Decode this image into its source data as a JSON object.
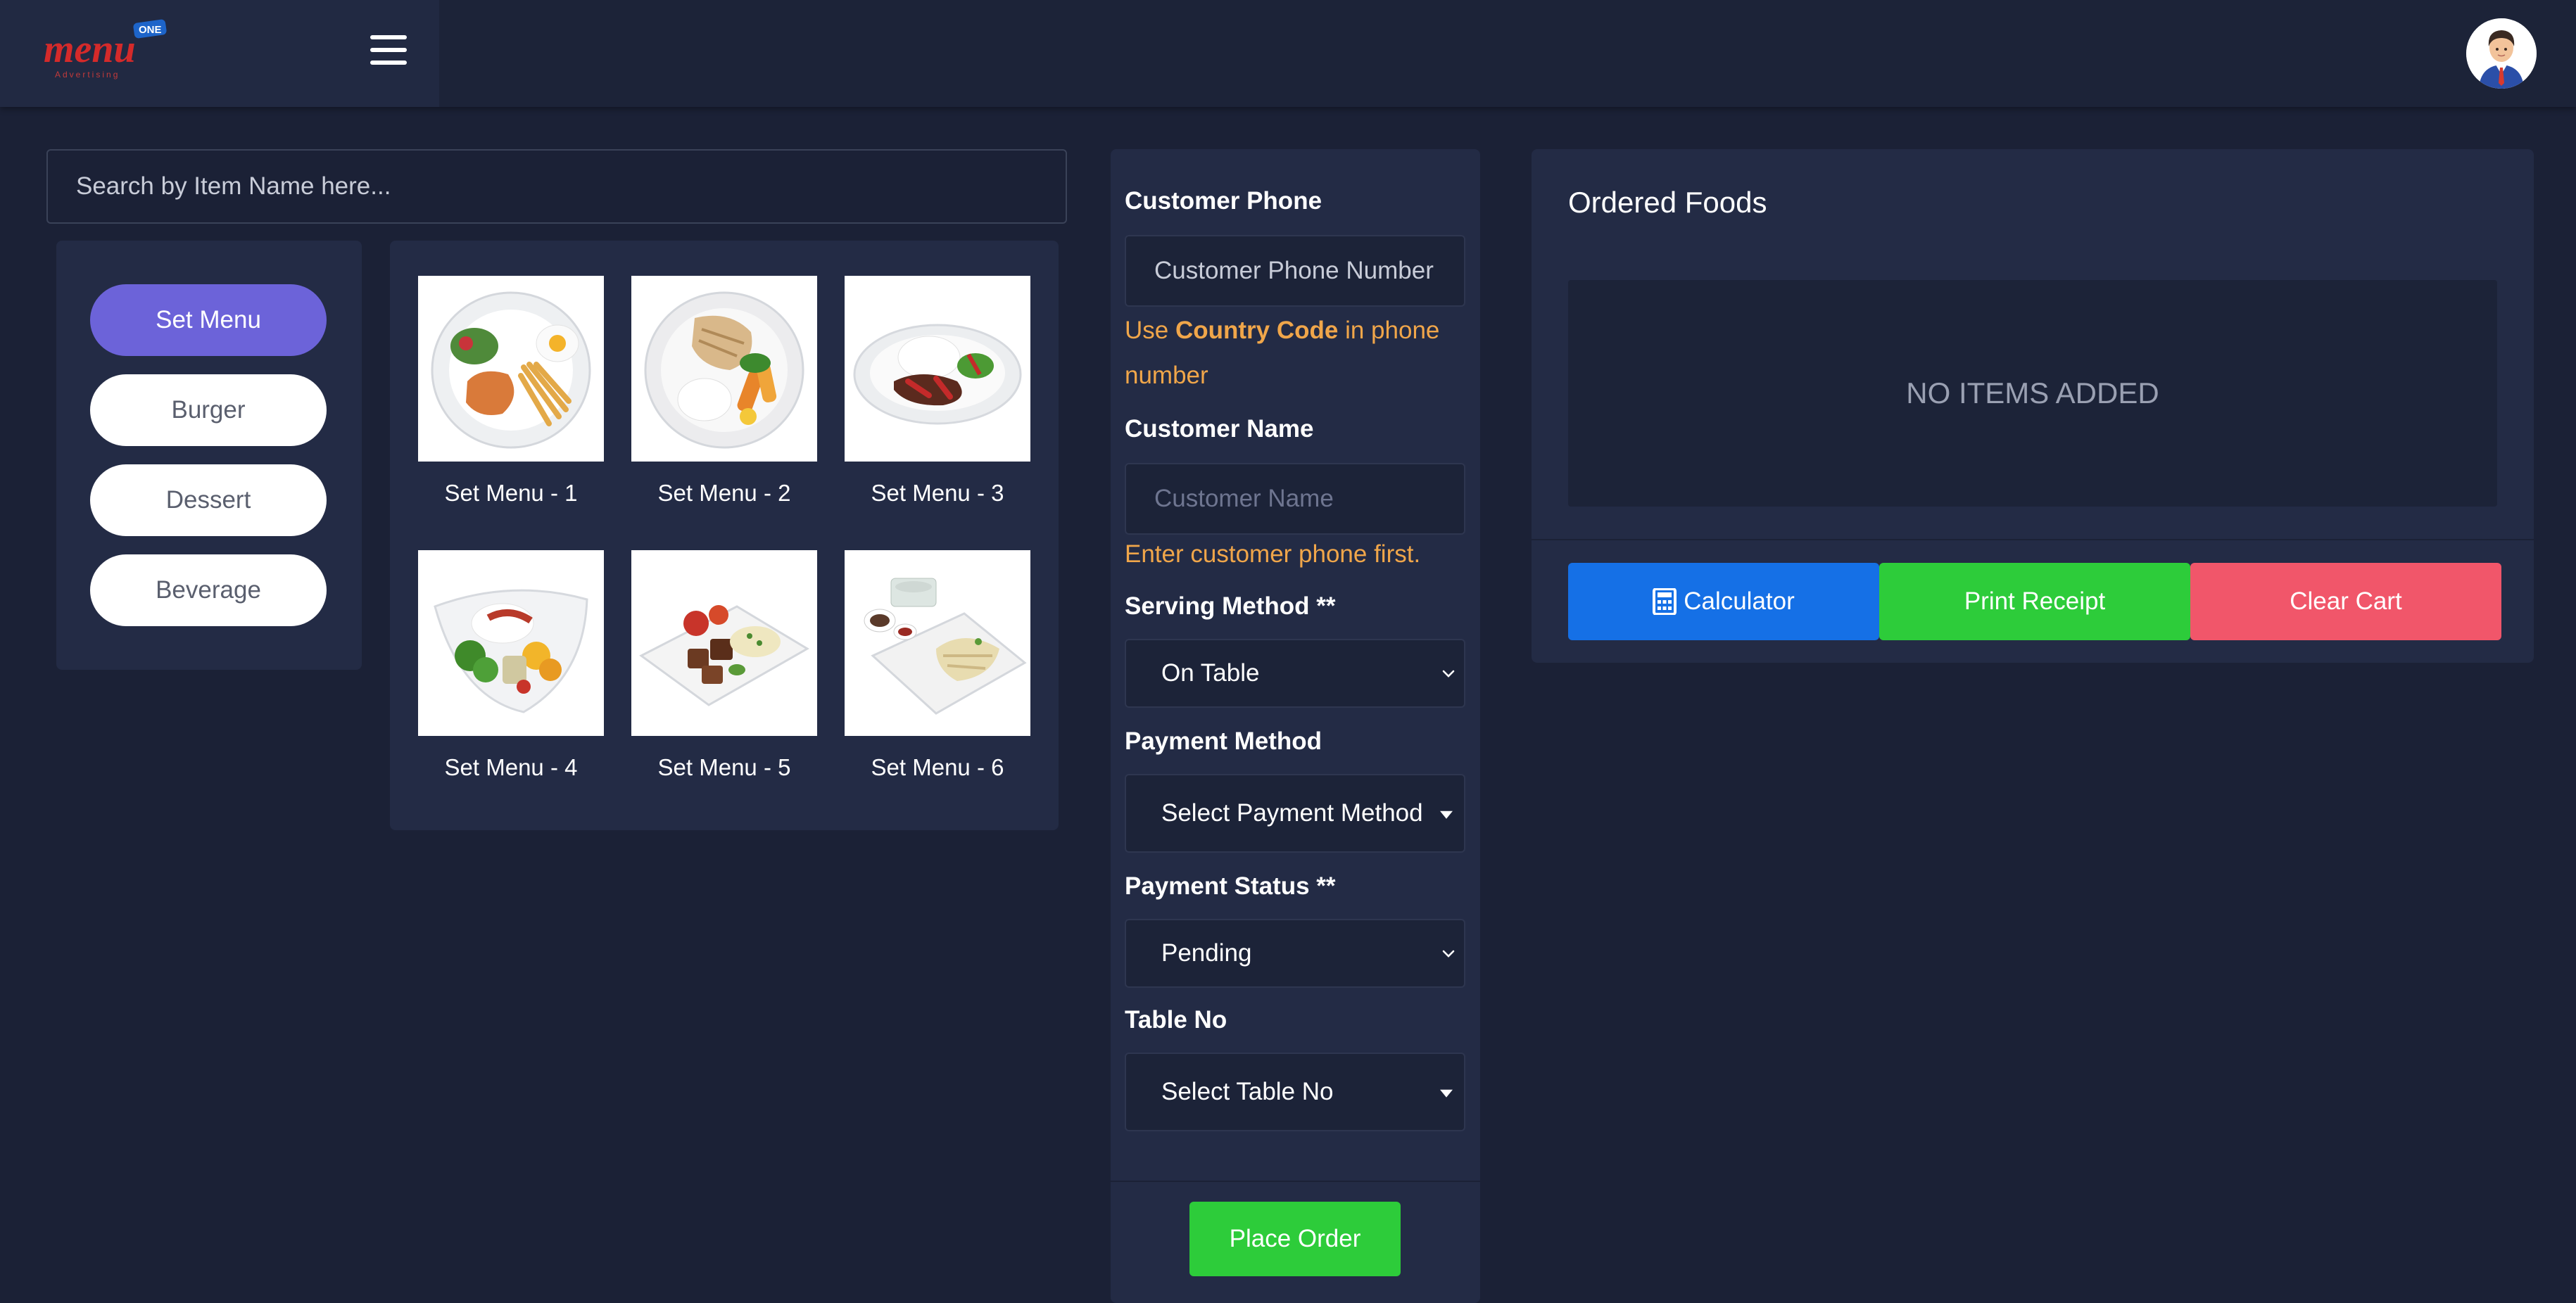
{
  "header": {
    "logo_text": "menu",
    "logo_badge": "ONE",
    "logo_sub": "Advertising"
  },
  "search": {
    "placeholder": "Search by Item Name here..."
  },
  "categories": [
    {
      "label": "Set Menu",
      "active": true
    },
    {
      "label": "Burger",
      "active": false
    },
    {
      "label": "Dessert",
      "active": false
    },
    {
      "label": "Beverage",
      "active": false
    }
  ],
  "menu_items": [
    {
      "label": "Set Menu - 1"
    },
    {
      "label": "Set Menu - 2"
    },
    {
      "label": "Set Menu - 3"
    },
    {
      "label": "Set Menu - 4"
    },
    {
      "label": "Set Menu - 5"
    },
    {
      "label": "Set Menu - 6"
    }
  ],
  "form": {
    "phone_label": "Customer Phone",
    "phone_placeholder": "Customer Phone Number",
    "phone_hint_pre": "Use ",
    "phone_hint_bold": "Country Code",
    "phone_hint_post": " in phone number",
    "name_label": "Customer Name",
    "name_placeholder": "Customer Name",
    "name_hint": "Enter customer phone first.",
    "serving_label": "Serving Method **",
    "serving_value": "On Table",
    "payment_method_label": "Payment Method",
    "payment_method_value": "Select Payment Method",
    "payment_status_label": "Payment Status **",
    "payment_status_value": "Pending",
    "table_label": "Table No",
    "table_value": "Select Table No",
    "place_order": "Place Order"
  },
  "orders": {
    "title": "Ordered Foods",
    "empty_text": "NO ITEMS ADDED",
    "calculator": "Calculator",
    "print": "Print Receipt",
    "clear": "Clear Cart"
  },
  "colors": {
    "background": "#1b2136",
    "panel": "#232b45",
    "accent_purple": "#6c63d9",
    "hint_orange": "#f0a64a",
    "button_blue": "#1570e6",
    "button_green": "#2dcc3a",
    "button_red": "#f1566a"
  }
}
